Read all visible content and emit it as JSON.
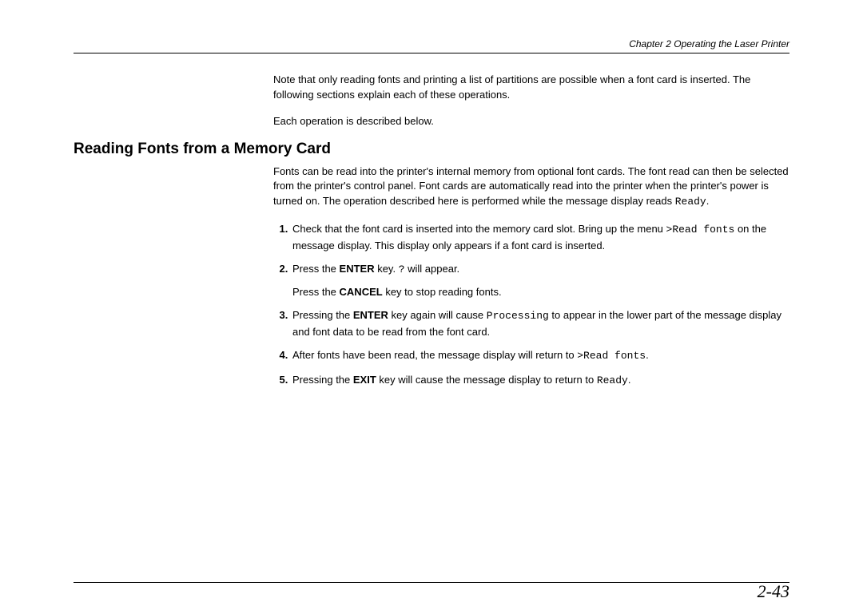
{
  "header": {
    "running_head": "Chapter 2  Operating the Laser Printer"
  },
  "intro": {
    "p1": "Note that only reading fonts and printing a list of partitions are possible when a font card is inserted.  The following sections explain each of these operations.",
    "p2": "Each operation is described below."
  },
  "section": {
    "heading": "Reading Fonts from a Memory Card",
    "lead_a": "Fonts can be read into the printer's internal memory from optional font cards.  The font read can then be selected from the printer's control panel.  Font cards are automatically read into the printer when the printer's power is turned on.  The operation described here is performed while the message display reads ",
    "lead_ready": "Ready",
    "lead_b": "."
  },
  "steps": {
    "s1_a": "Check that the font card is inserted into the memory card slot.  Bring up the menu ",
    "s1_menu": ">Read fonts",
    "s1_b": " on the message display.  This display only appears if a font card is inserted.",
    "s2_a": "Press the ",
    "s2_enter": "ENTER",
    "s2_b": " key. ",
    "s2_q": "?",
    "s2_c": " will appear.",
    "s2_d": "Press the ",
    "s2_cancel": "CANCEL",
    "s2_e": " key to stop reading fonts.",
    "s3_a": "Pressing the ",
    "s3_enter": "ENTER",
    "s3_b": " key again will cause ",
    "s3_proc": "Processing",
    "s3_c": " to appear in the lower part of the message display and font data to be read from the font card.",
    "s4_a": "After fonts have been read, the message display will return to ",
    "s4_menu": ">Read fonts",
    "s4_b": ".",
    "s5_a": "Pressing the ",
    "s5_exit": "EXIT",
    "s5_b": " key will cause the message display to return to ",
    "s5_ready": "Ready",
    "s5_c": "."
  },
  "footer": {
    "page_number": "2-43"
  }
}
